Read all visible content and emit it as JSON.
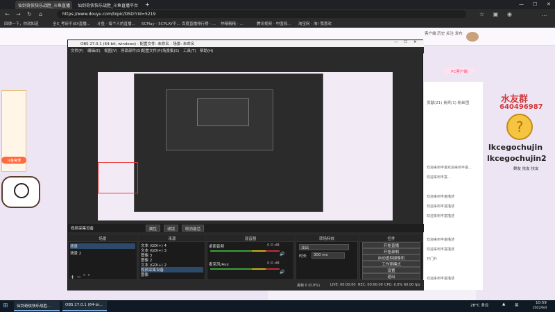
{
  "browser": {
    "tabs": [
      {
        "label": "仙剑奇侠快乐战胜_斗鱼直播",
        "active": true
      },
      {
        "label": "仙剑奇侠快乐战胜_斗鱼直播平台",
        "active": false
      }
    ],
    "url": "https://www.douyu.com/topic/DSD?rid=5219",
    "favorites": [
      "四律一下，你就知道",
      "全X_考研平台X直播...",
      "斗鱼 - 每个人的直播...",
      "5CPlay - 5CPLAY平...",
      "百度直播排行榜 - ...",
      "仲精精精 - ...",
      "腾讯视频 - 中国领...",
      "淘宝网 - 淘! 我喜欢"
    ]
  },
  "site": {
    "header_right_labels": [
      "客户端",
      "历史",
      "关注",
      "发布",
      "个人中心"
    ],
    "pc_client_btn": "PC客户端",
    "right_name": "水友群",
    "right_number": "640496987",
    "right_handle_1": "lkcegochujin",
    "right_handle_2": "lkcegochujin2",
    "right_small": "群友 扶友 扶友",
    "chat_tabs": [
      "贡献(21)",
      "贵宾(1)",
      "粉丝团"
    ],
    "chat_lines": [
      "欢迎来到丰富欢迎来到丰富...",
      "欢迎来到丰富...",
      "欢迎来到丰富描述",
      "欢迎来到丰富描述",
      "欢迎来到丰富描述",
      "欢迎来到丰富描述",
      "欢迎来到丰富描述",
      "开门升",
      "欢迎来到丰富描述"
    ],
    "left_badge": "斗鱼官博"
  },
  "obs": {
    "title": "OBS 27.0.1 (64-bit, windows) - 配置文件: 未命名 - 场景: 未命名",
    "menu": [
      "文件(F)",
      "编辑(E)",
      "视图(V)",
      "停靠部件(D)",
      "配置文件(P)",
      "场景集(S)",
      "工具(T)",
      "帮助(H)"
    ],
    "source_bar_label": "视频采集设备",
    "ctx_buttons": [
      "属性",
      "滤镜",
      "取消激活"
    ],
    "docks": {
      "scenes": {
        "title": "场景",
        "items": [
          "场景",
          "场景 2"
        ]
      },
      "sources": {
        "title": "来源",
        "items": [
          "文本 (GDI+) 4",
          "文本 (GDI+) 3",
          "图像 3",
          "图像 2",
          "文本 (GDI+) 2",
          "视频采集设备",
          "图像"
        ]
      },
      "mixer": {
        "title": "混音器",
        "tracks": [
          {
            "name": "桌面音频",
            "value": "0.0 dB"
          },
          {
            "name": "麦克风/Aux",
            "value": "0.0 dB"
          }
        ]
      },
      "transitions": {
        "title": "转场特效",
        "type": "淡出",
        "duration_label": "时长",
        "duration": "300 ms"
      },
      "controls": {
        "title": "控件",
        "buttons": [
          "开始直播",
          "开始录制",
          "启动虚拟摄像机",
          "工作室模式",
          "设置",
          "退出"
        ]
      }
    },
    "status": [
      "丢帧 0 (0.0%)",
      "LIVE: 00:00:00",
      "REC: 00:00:00",
      "CPU: 0.0%",
      "60.00 fps"
    ]
  },
  "taskbar": {
    "tasks": [
      "仙剑奇侠快乐战胜...",
      "OBS 27.0.1 (64-bi..."
    ],
    "weather": "28°C 多云",
    "lang": "英",
    "time": "10:59",
    "date": "2022/6/4"
  },
  "colors": {
    "accent_orange": "#f07a18",
    "douyu_pink": "#ff5a8a",
    "obs_bg": "#2a2a2a"
  }
}
